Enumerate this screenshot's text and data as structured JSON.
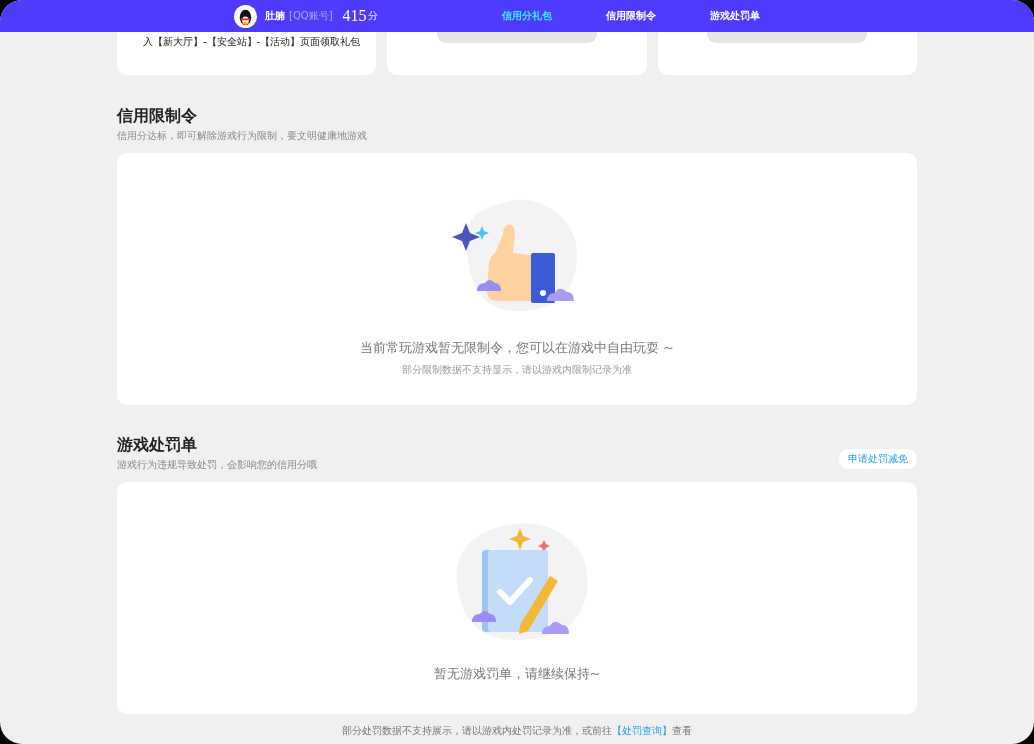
{
  "header": {
    "nickname": "肚腩",
    "account_type": "[QQ账号]",
    "score": "415",
    "score_unit": "分",
    "nav": [
      {
        "label": "信用分礼包",
        "selected": true
      },
      {
        "label": "信用限制令",
        "selected": false
      },
      {
        "label": "游戏处罚单",
        "selected": false
      }
    ]
  },
  "top_cards": [
    {
      "kind": "text",
      "text": "入【新大厅】-【安全站】-【活动】页面领取礼包"
    },
    {
      "kind": "button"
    },
    {
      "kind": "button"
    }
  ],
  "sections": [
    {
      "title": "信用限制令",
      "subtitle": "信用分达标，即可解除游戏行为限制，要文明健康地游戏",
      "empty": {
        "kind": "thumbs",
        "message": "当前常玩游戏暂无限制令，您可以在游戏中自由玩耍 ~",
        "note": "部分限制数据不支持显示，请以游戏内限制记录为准"
      }
    },
    {
      "title": "游戏处罚单",
      "subtitle": "游戏行为违规导致处罚，会影响您的信用分哦",
      "action": "申请处罚减免",
      "empty": {
        "kind": "document",
        "message": "暂无游戏罚单，请继续保持~"
      }
    }
  ],
  "footer_note": {
    "text": "部分处罚数据不支持展示，请以游戏内处罚记录为准，或前往",
    "link": "【处罚查询】",
    "suffix": "查看"
  }
}
